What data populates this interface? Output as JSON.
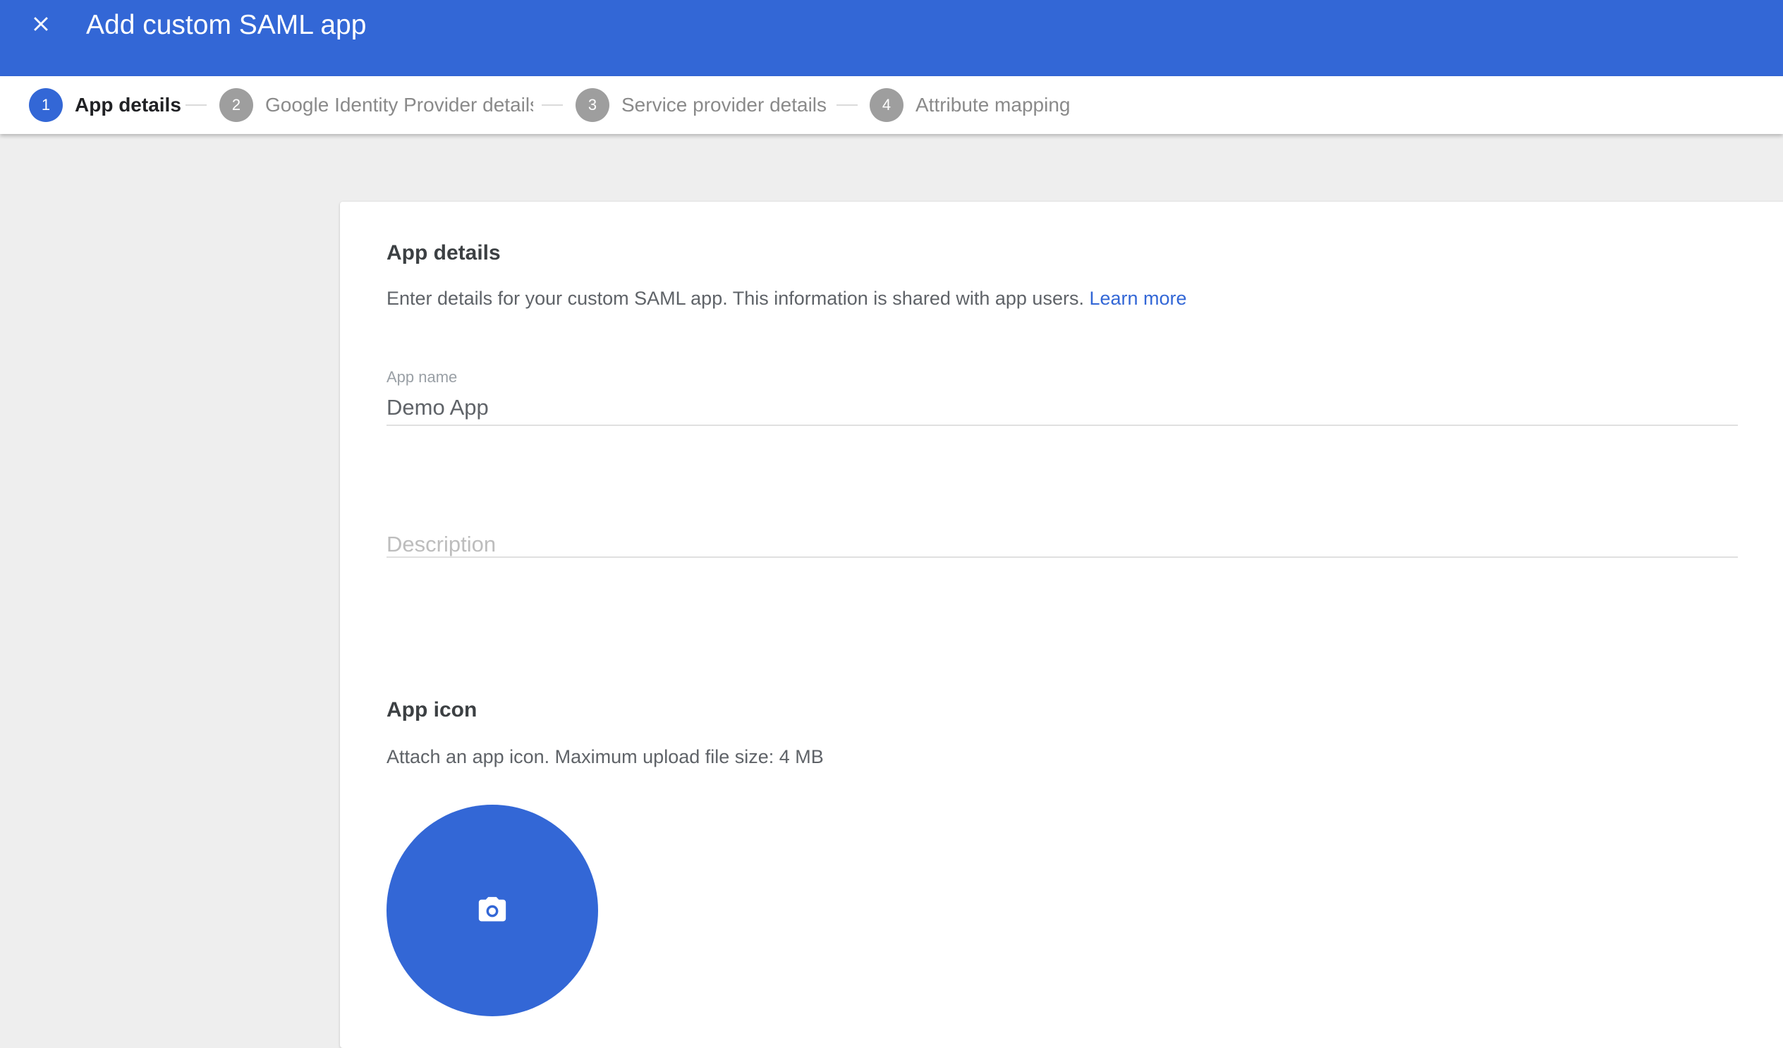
{
  "header": {
    "title": "Add custom SAML app",
    "close_icon": "close-icon"
  },
  "stepper": {
    "steps": [
      {
        "number": "1",
        "label": "App details",
        "active": true
      },
      {
        "number": "2",
        "label": "Google Identity Provider details",
        "active": false
      },
      {
        "number": "3",
        "label": "Service provider details",
        "active": false
      },
      {
        "number": "4",
        "label": "Attribute mapping",
        "active": false
      }
    ]
  },
  "app_details": {
    "title": "App details",
    "description": "Enter details for your custom SAML app. This information is shared with app users.",
    "learn_more": "Learn more",
    "app_name": {
      "label": "App name",
      "value": "Demo App"
    },
    "description_field": {
      "placeholder": "Description",
      "value": ""
    }
  },
  "app_icon": {
    "title": "App icon",
    "description": "Attach an app icon. Maximum upload file size: 4 MB",
    "upload_icon": "camera-icon"
  },
  "colors": {
    "primary": "#3367d6",
    "inactive_step": "#9e9e9e",
    "background": "#eeeeee"
  }
}
